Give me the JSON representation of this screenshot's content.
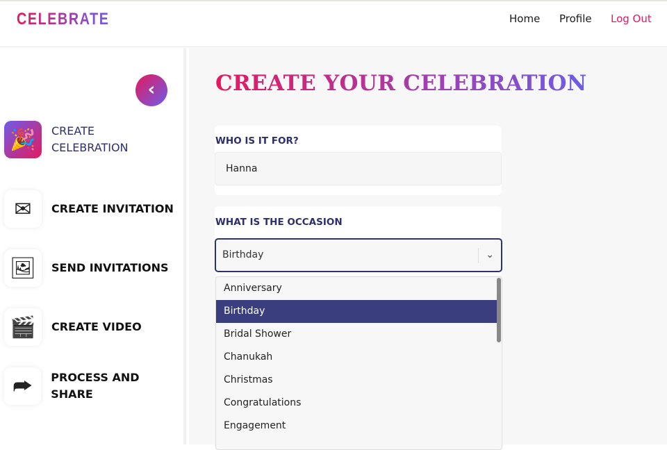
{
  "header": {
    "logo": "CELEBRATE",
    "nav": [
      "Home",
      "Profile",
      "Log Out"
    ],
    "logout_color": "#e5195e"
  },
  "sidebar": {
    "items": [
      {
        "label_line1": "CREATE",
        "label_line2": "CELEBRATION",
        "icon": "party-popper-icon"
      },
      {
        "label": "CREATE INVITATION",
        "icon": "invitation-envelope-icon"
      },
      {
        "label": "SEND INVITATIONS",
        "icon": "send-card-icon"
      },
      {
        "label": "CREATE VIDEO",
        "icon": "clapperboard-icon"
      },
      {
        "label": "PROCESS AND SHARE",
        "icon": "share-video-icon"
      }
    ]
  },
  "main": {
    "title": "CREATE YOUR CELEBRATION",
    "who_label": "WHO IS IT FOR?",
    "who_value": "Hanna",
    "occasion_label": "WHAT IS THE OCCASION",
    "occasion_value": "Birthday",
    "options": [
      "Anniversary",
      "Birthday",
      "Bridal Shower",
      "Chanukah",
      "Christmas",
      "Congratulations",
      "Engagement"
    ]
  }
}
